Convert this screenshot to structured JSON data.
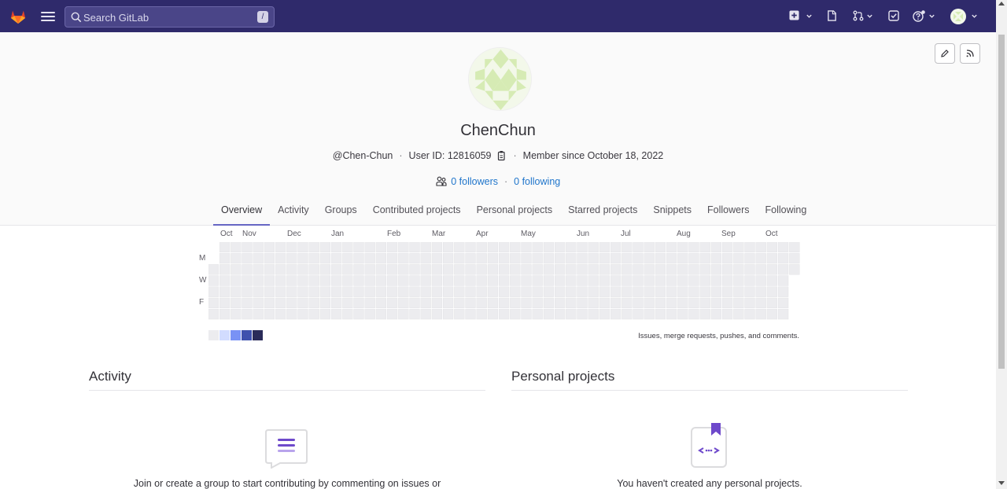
{
  "search": {
    "placeholder": "Search GitLab",
    "shortcut": "/"
  },
  "nav_icons": [
    "create-new-icon",
    "issues-icon",
    "merge-requests-icon",
    "todos-icon",
    "help-icon",
    "user-avatar"
  ],
  "profile": {
    "name": "ChenChun",
    "username": "@Chen-Chun",
    "user_id": "User ID: 12816059",
    "member_since": "Member since October 18, 2022",
    "followers": "0 followers",
    "following": "0 following"
  },
  "tabs": [
    {
      "label": "Overview",
      "active": true
    },
    {
      "label": "Activity"
    },
    {
      "label": "Groups"
    },
    {
      "label": "Contributed projects"
    },
    {
      "label": "Personal projects"
    },
    {
      "label": "Starred projects"
    },
    {
      "label": "Snippets"
    },
    {
      "label": "Followers"
    },
    {
      "label": "Following"
    }
  ],
  "calendar": {
    "months": [
      "Oct",
      "Nov",
      "Dec",
      "Jan",
      "Feb",
      "Mar",
      "Apr",
      "May",
      "Jun",
      "Jul",
      "Aug",
      "Sep",
      "Oct"
    ],
    "days": [
      "M",
      "W",
      "F"
    ],
    "legend_colors": [
      "#ececef",
      "#d2dcff",
      "#7992f5",
      "#3f51ae",
      "#2a2b59"
    ],
    "note": "Issues, merge requests, pushes, and comments.",
    "empty_color": "#ececef"
  },
  "activity": {
    "title": "Activity",
    "empty_text": "Join or create a group to start contributing by commenting on issues or"
  },
  "personal_projects": {
    "title": "Personal projects",
    "empty_text": "You haven't created any personal projects."
  },
  "colors": {
    "nav_bg": "#2f2a6b",
    "link": "#1f75cb",
    "tab_active": "#6666c4",
    "illustration_purple": "#6e49cb"
  }
}
